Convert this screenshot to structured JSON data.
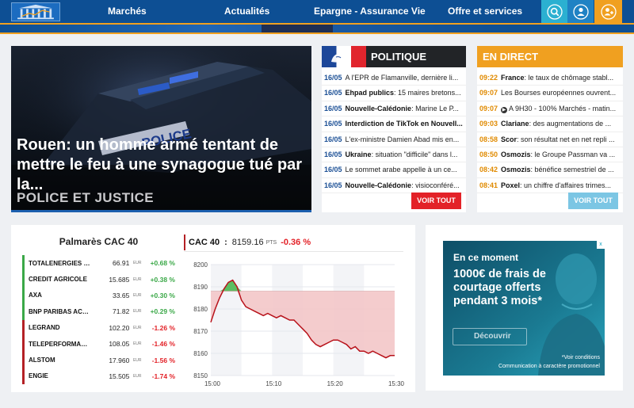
{
  "nav": {
    "items": [
      {
        "label": "Marchés"
      },
      {
        "label": "Actualités"
      },
      {
        "label": "Epargne - Assurance Vie"
      },
      {
        "label": "Offre et services"
      }
    ],
    "colors": {
      "bar": "#0d4f94",
      "accent": "#f0a020",
      "search": "#2bb0d1",
      "user": "#1f82c4",
      "signup": "#f0a020"
    }
  },
  "hero": {
    "headline": "Rouen: un homme armé tentant de mettre le feu à une synagogue tué par la...",
    "category": "POLICE ET JUSTICE",
    "image_text": "POLICE"
  },
  "politique": {
    "title": "POLITIQUE",
    "items": [
      {
        "date": "16/05",
        "bold": "",
        "text": "A l'EPR de Flamanville, dernière li..."
      },
      {
        "date": "16/05",
        "bold": "Ehpad publics",
        "text": ": 15 maires bretons..."
      },
      {
        "date": "16/05",
        "bold": "Nouvelle-Calédonie",
        "text": ": Marine Le P..."
      },
      {
        "date": "16/05",
        "bold": "Interdiction de TikTok en Nouvell...",
        "text": ""
      },
      {
        "date": "16/05",
        "bold": "",
        "text": "L'ex-ministre Damien Abad mis en..."
      },
      {
        "date": "16/05",
        "bold": "Ukraine",
        "text": ": situation \"difficile\" dans l..."
      },
      {
        "date": "16/05",
        "bold": "",
        "text": "Le sommet arabe appelle à un ce..."
      },
      {
        "date": "16/05",
        "bold": "Nouvelle-Calédonie",
        "text": ": visioconféré..."
      }
    ],
    "button": "VOIR TOUT"
  },
  "direct": {
    "title": "EN DIRECT",
    "items": [
      {
        "time": "09:22",
        "bold": "France",
        "text": ": le taux de chômage stabl...",
        "video": false
      },
      {
        "time": "09:07",
        "bold": "",
        "text": "Les Bourses européennes ouvrent...",
        "video": false
      },
      {
        "time": "09:07",
        "bold": "",
        "text": "A 9H30 - 100% Marchés - matin...",
        "video": true
      },
      {
        "time": "09:03",
        "bold": "Clariane",
        "text": ": des augmentations de ...",
        "video": false
      },
      {
        "time": "08:58",
        "bold": "Scor",
        "text": ": son résultat net en net repli ...",
        "video": false
      },
      {
        "time": "08:50",
        "bold": "Osmozis",
        "text": ": le Groupe Passman va ...",
        "video": false
      },
      {
        "time": "08:42",
        "bold": "Osmozis",
        "text": ": bénéfice semestriel de ...",
        "video": false
      },
      {
        "time": "08:41",
        "bold": "Poxel",
        "text": ": un chiffre d'affaires trimes...",
        "video": false
      }
    ],
    "button": "VOIR TOUT"
  },
  "palmares": {
    "title": "Palmarès CAC 40",
    "currency": "EUR",
    "rows": [
      {
        "name": "TOTALENERGIES SE",
        "price": "66.91",
        "change": "+0.68 %",
        "up": true
      },
      {
        "name": "CREDIT AGRICOLE",
        "price": "15.685",
        "change": "+0.38 %",
        "up": true
      },
      {
        "name": "AXA",
        "price": "33.65",
        "change": "+0.30 %",
        "up": true
      },
      {
        "name": "BNP PARIBAS ACT.A",
        "price": "71.82",
        "change": "+0.29 %",
        "up": true
      },
      {
        "name": "LEGRAND",
        "price": "102.20",
        "change": "-1.26 %",
        "up": false
      },
      {
        "name": "TELEPERFORMANC...",
        "price": "108.05",
        "change": "-1.46 %",
        "up": false
      },
      {
        "name": "ALSTOM",
        "price": "17.960",
        "change": "-1.56 %",
        "up": false
      },
      {
        "name": "ENGIE",
        "price": "15.505",
        "change": "-1.74 %",
        "up": false
      }
    ]
  },
  "cac": {
    "label": "CAC 40",
    "separator": ":",
    "value": "8159.16",
    "unit": "PTS",
    "change": "-0.36 %"
  },
  "chart_data": {
    "type": "area",
    "title": "",
    "xlabel": "",
    "ylabel": "",
    "reference": 8188,
    "x_ticks": [
      "15:00",
      "15:10",
      "15:20",
      "15:30"
    ],
    "y_ticks": [
      8150,
      8160,
      8170,
      8180,
      8190,
      8200
    ],
    "ylim": [
      8150,
      8200
    ],
    "xlim": [
      0,
      42
    ],
    "x": [
      0,
      1,
      2,
      3,
      4,
      5,
      6,
      7,
      8,
      9,
      10,
      11,
      12,
      13,
      14,
      15,
      16,
      17,
      18,
      19,
      20,
      21,
      22,
      23,
      24,
      25,
      26,
      27,
      28,
      29,
      30,
      31,
      32,
      33,
      34,
      35,
      36,
      37,
      38,
      39,
      40,
      41,
      42
    ],
    "values": [
      8174,
      8180,
      8185,
      8189,
      8192,
      8193,
      8190,
      8184,
      8181,
      8180,
      8179,
      8178,
      8177,
      8178,
      8177,
      8176,
      8177,
      8176,
      8175,
      8175,
      8173,
      8171,
      8169,
      8166,
      8164,
      8163,
      8164,
      8165,
      8166,
      8166,
      8165,
      8164,
      8162,
      8163,
      8161,
      8161,
      8160,
      8161,
      8160,
      8159,
      8158,
      8159,
      8159
    ],
    "colors": {
      "line": "#b8121a",
      "below": "#f3c6c8",
      "above": "#5cbf62"
    }
  },
  "ad": {
    "line1": "En ce moment",
    "line2": "1000€ de frais de courtage offerts pendant 3 mois*",
    "button": "Découvrir",
    "foot1": "*Voir conditions",
    "foot2": "Communication à caractère promotionnel",
    "badge": "x"
  }
}
